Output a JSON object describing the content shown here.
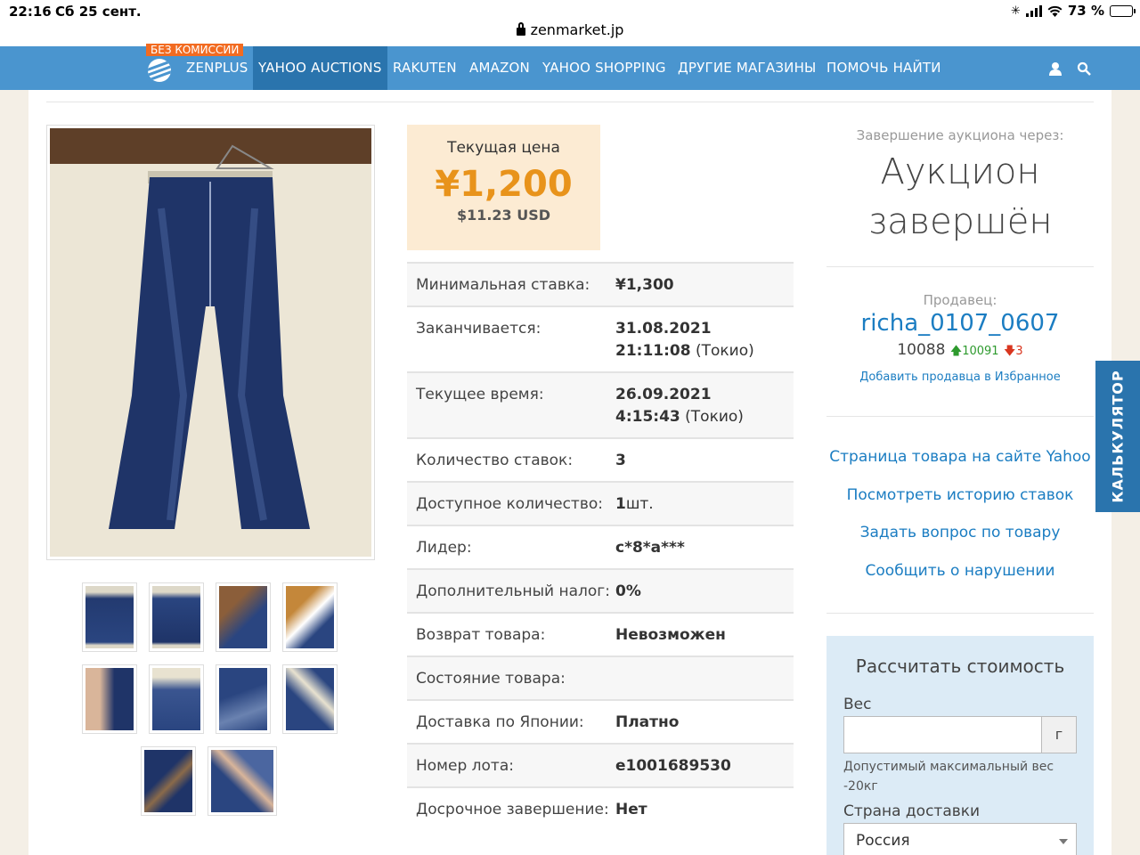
{
  "status_bar": {
    "time": "22:16",
    "date": "Сб 25 сент.",
    "url": "zenmarket.jp",
    "battery": "73 %",
    "battery_level": 0.73
  },
  "nav": {
    "promo_badge": "БЕЗ КОМИССИИ",
    "items": [
      "ZENPLUS",
      "YAHOO AUCTIONS",
      "RAKUTEN",
      "AMAZON",
      "YAHOO SHOPPING",
      "ДРУГИЕ МАГАЗИНЫ",
      "ПОМОЧЬ НАЙТИ"
    ],
    "active": "YAHOO AUCTIONS",
    "icons": [
      "user-icon",
      "search-icon"
    ]
  },
  "price": {
    "label": "Текущая цена",
    "value": "¥1,200",
    "usd": "$11.23 USD"
  },
  "details": [
    {
      "label": "Минимальная ставка:",
      "value": "¥1,300"
    },
    {
      "label": "Заканчивается:",
      "value": "31.08.2021",
      "value2": "21:11:08",
      "suffix": " (Токио)"
    },
    {
      "label": "Текущее время:",
      "value": "26.09.2021",
      "value2": "4:15:43",
      "suffix": " (Токио)"
    },
    {
      "label": "Количество ставок:",
      "value": "3"
    },
    {
      "label": "Доступное количество:",
      "value": "1",
      "suffix": "шт."
    },
    {
      "label": "Лидер:",
      "value": "c*8*a***"
    },
    {
      "label": "Дополнительный налог:",
      "value": "0%"
    },
    {
      "label": "Возврат товара:",
      "value": "Невозможен"
    },
    {
      "label": "Состояние товара:",
      "value": ""
    },
    {
      "label": "Доставка по Японии:",
      "value": "Платно"
    },
    {
      "label": "Номер лота:",
      "value": "e1001689530"
    },
    {
      "label": "Досрочное завершение:",
      "value": "Нет"
    }
  ],
  "auction_end": {
    "label": "Завершение аукциона через:",
    "value": "Аукцион завершён"
  },
  "seller": {
    "label": "Продавец:",
    "name": "richa_0107_0607",
    "rating": "10088",
    "positive": "10091",
    "negative": "3",
    "add_favorite": "Добавить продавца в Избранное"
  },
  "links": [
    "Страница товара на сайте Yahoo",
    "Посмотреть историю ставок",
    "Задать вопрос по товару",
    "Сообщить о нарушении"
  ],
  "calculator": {
    "title": "Рассчитать стоимость",
    "weight_label": "Вес",
    "weight_value": "",
    "unit": "г",
    "hint": "Допустимый максимальный вес -20кг",
    "country_label": "Страна доставки",
    "country": "Россия",
    "tab": "КАЛЬКУЛЯТОР"
  },
  "photos": {
    "main": "jeans-photo",
    "thumbnails": 10
  }
}
